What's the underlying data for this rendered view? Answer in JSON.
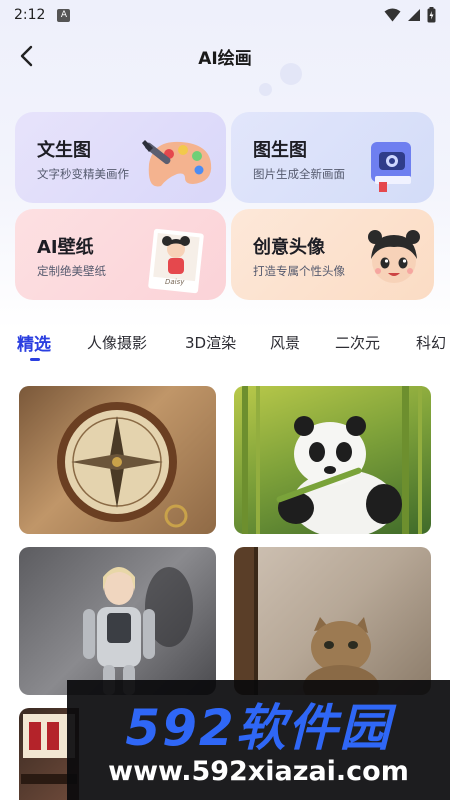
{
  "status": {
    "time": "2:12",
    "notif": "A"
  },
  "header": {
    "title": "AI绘画"
  },
  "cards": [
    {
      "title": "文生图",
      "subtitle": "文字秒变精美画作",
      "icon": "palette-icon"
    },
    {
      "title": "图生图",
      "subtitle": "图片生成全新画面",
      "icon": "camera-book-icon"
    },
    {
      "title": "AI壁纸",
      "subtitle": "定制绝美壁纸",
      "icon": "cartoon-photo-icon",
      "photo_caption": "Daisy"
    },
    {
      "title": "创意头像",
      "subtitle": "打造专属个性头像",
      "icon": "cartoon-avatar-icon"
    }
  ],
  "tabs": [
    "精选",
    "人像摄影",
    "3D渲染",
    "风景",
    "二次元",
    "科幻"
  ],
  "active_tab": 0,
  "gallery": [
    {
      "name": "compass"
    },
    {
      "name": "panda"
    },
    {
      "name": "robot-woman"
    },
    {
      "name": "cat"
    },
    {
      "name": "sign"
    }
  ],
  "watermark": {
    "brand": "592软件园",
    "url": "www.592xiazai.com"
  },
  "colors": {
    "accent": "#2b3fe0",
    "watermark_blue": "#2f67f6"
  }
}
